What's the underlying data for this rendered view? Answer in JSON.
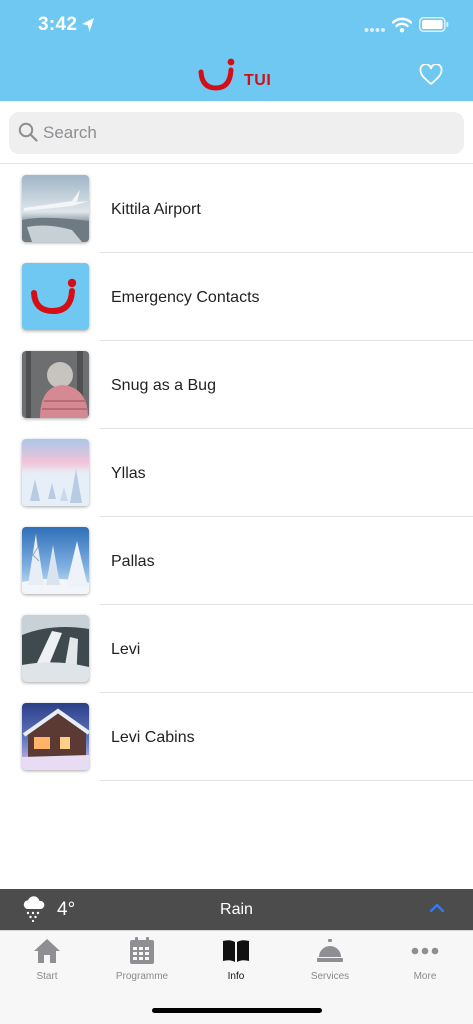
{
  "status": {
    "time": "3:42"
  },
  "header": {
    "brand": "TUI"
  },
  "colors": {
    "header_bg": "#6ec8f2",
    "brand_red": "#d40e14",
    "weather_bg": "#4c4c4c",
    "accent_blue": "#2f7bf5"
  },
  "search": {
    "placeholder": "Search",
    "value": ""
  },
  "list": {
    "items": [
      {
        "label": "Kittila Airport",
        "thumb": "airport-wing-photo"
      },
      {
        "label": "Emergency Contacts",
        "thumb": "tui-logo"
      },
      {
        "label": "Snug as a Bug",
        "thumb": "knit-hat-photo"
      },
      {
        "label": "Yllas",
        "thumb": "snowy-forest-pink-sky-photo"
      },
      {
        "label": "Pallas",
        "thumb": "snowy-trees-blue-sky-photo"
      },
      {
        "label": "Levi",
        "thumb": "ski-slope-photo"
      },
      {
        "label": "Levi Cabins",
        "thumb": "cabin-dusk-photo"
      }
    ]
  },
  "weather": {
    "temperature": "4°",
    "condition": "Rain",
    "icon": "rain-cloud-icon"
  },
  "tabs": [
    {
      "label": "Start",
      "icon": "home-icon",
      "active": false
    },
    {
      "label": "Programme",
      "icon": "calendar-icon",
      "active": false
    },
    {
      "label": "Info",
      "icon": "book-icon",
      "active": true
    },
    {
      "label": "Services",
      "icon": "service-bell-icon",
      "active": false
    },
    {
      "label": "More",
      "icon": "more-dots-icon",
      "active": false
    }
  ]
}
